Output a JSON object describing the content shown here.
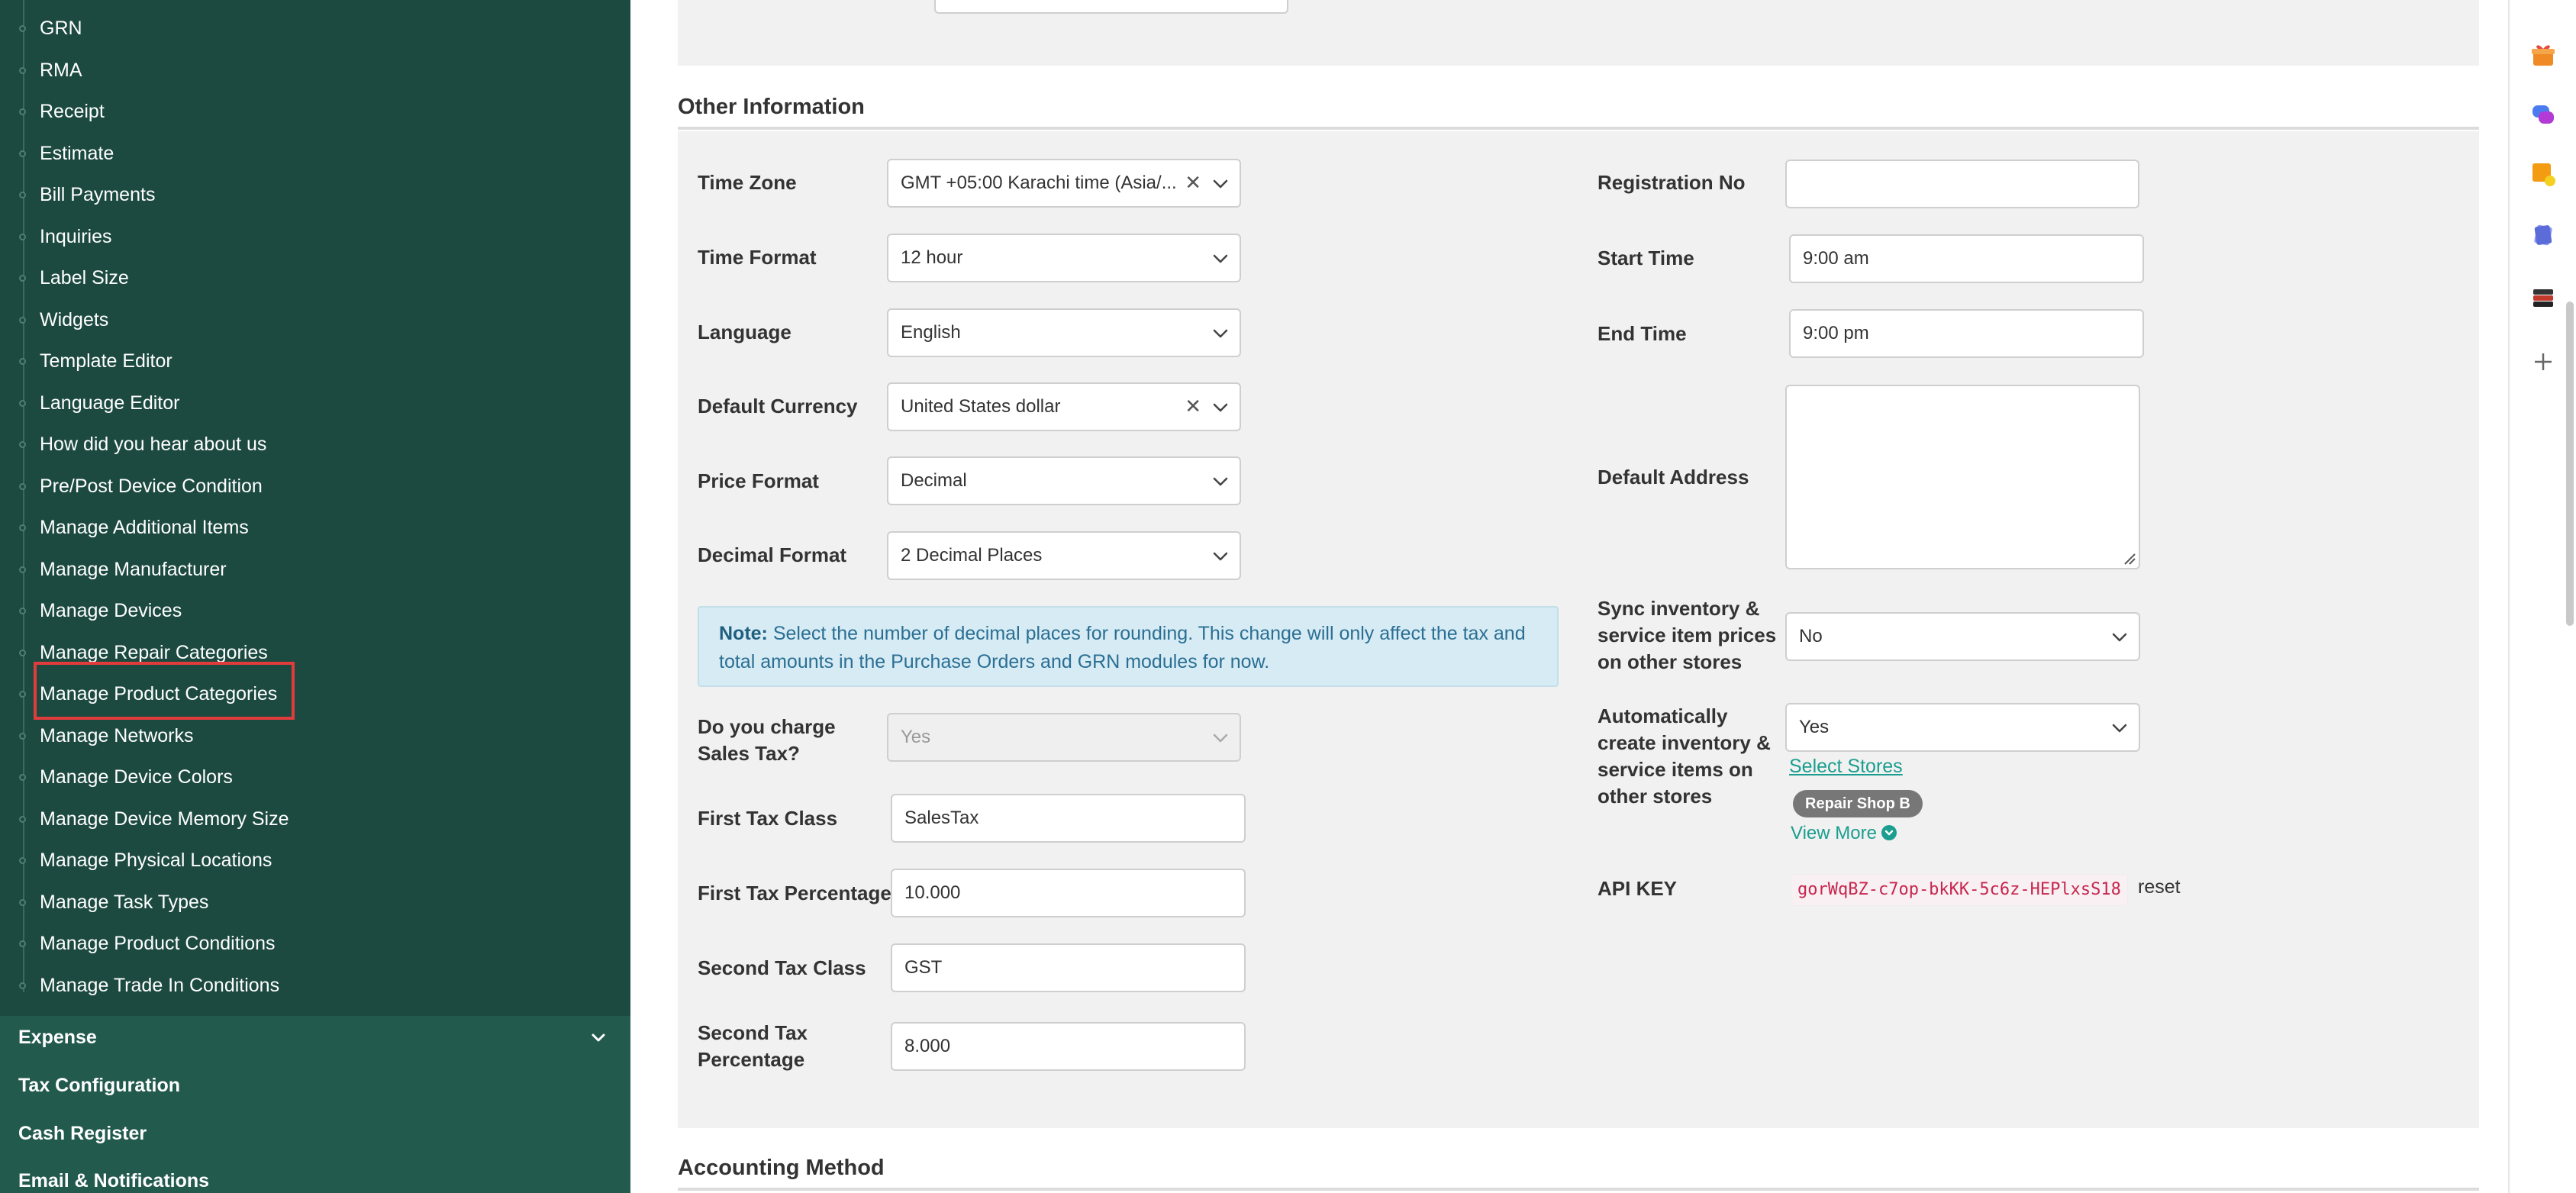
{
  "sidebar": {
    "sub_items": [
      "GRN",
      "RMA",
      "Receipt",
      "Estimate",
      "Bill Payments",
      "Inquiries",
      "Label Size",
      "Widgets",
      "Template Editor",
      "Language Editor",
      "How did you hear about us",
      "Pre/Post Device Condition",
      "Manage Additional Items",
      "Manage Manufacturer",
      "Manage Devices",
      "Manage Repair Categories",
      "Manage Product Categories",
      "Manage Networks",
      "Manage Device Colors",
      "Manage Device Memory Size",
      "Manage Physical Locations",
      "Manage Task Types",
      "Manage Product Conditions",
      "Manage Trade In Conditions"
    ],
    "highlighted_item": "Manage Product Categories",
    "main_items": {
      "expense": "Expense",
      "tax_configuration": "Tax Configuration",
      "cash_register": "Cash Register",
      "email_notifications": "Email & Notifications"
    }
  },
  "main": {
    "other_information": {
      "title": "Other Information",
      "left": {
        "time_zone": {
          "label": "Time Zone",
          "value": "GMT +05:00 Karachi time (Asia/..."
        },
        "time_format": {
          "label": "Time Format",
          "value": "12 hour"
        },
        "language": {
          "label": "Language",
          "value": "English"
        },
        "default_currency": {
          "label": "Default Currency",
          "value": "United States dollar"
        },
        "price_format": {
          "label": "Price Format",
          "value": "Decimal"
        },
        "decimal_format": {
          "label": "Decimal Format",
          "value": "2 Decimal Places"
        },
        "note": {
          "prefix": "Note:",
          "text": "Select the number of decimal places for rounding. This change will only affect the tax and total amounts in the Purchase Orders and GRN modules for now."
        },
        "charge_sales_tax": {
          "label": "Do you charge Sales Tax?",
          "value": "Yes"
        },
        "first_tax_class": {
          "label": "First Tax Class",
          "value": "SalesTax"
        },
        "first_tax_percentage": {
          "label": "First Tax Percentage",
          "value": "10.000"
        },
        "second_tax_class": {
          "label": "Second Tax Class",
          "value": "GST"
        },
        "second_tax_percentage": {
          "label": "Second Tax Percentage",
          "value": "8.000"
        }
      },
      "right": {
        "registration_no": {
          "label": "Registration No",
          "value": ""
        },
        "start_time": {
          "label": "Start Time",
          "value": "9:00 am"
        },
        "end_time": {
          "label": "End Time",
          "value": "9:00 pm"
        },
        "default_address": {
          "label": "Default Address",
          "value": ""
        },
        "sync_inventory": {
          "label": "Sync inventory & service item prices on other stores",
          "value": "No"
        },
        "auto_create": {
          "label": "Automatically create inventory & service items on other stores",
          "value": "Yes"
        },
        "select_stores": "Select Stores",
        "store_badge": "Repair Shop B",
        "view_more": "View More",
        "api_key": {
          "label": "API KEY",
          "value": "gorWqBZ-c7op-bkKK-5c6z-HEPlxsS18",
          "reset": "reset"
        }
      }
    },
    "accounting_method": {
      "title": "Accounting Method"
    }
  },
  "rail": {
    "icons": [
      "gift-icon",
      "chat-bubble-icon",
      "sticky-note-icon",
      "cards-icon",
      "stack-icon",
      "plus-icon"
    ],
    "colors": {
      "gift": "#f08a24",
      "chat": "#4a7cf0",
      "note": "#f39c12",
      "cards": "#5b6cd8",
      "stack": "#c0392b",
      "plus": "#666666"
    }
  },
  "colors": {
    "sidebar_bg": "#1c4a41",
    "sidebar_nav_bg": "#235a4e",
    "accent": "#1a9e8f",
    "highlight_border": "#e03c3c",
    "note_bg": "#d6ebf4",
    "api_key_text": "#c7254e"
  }
}
